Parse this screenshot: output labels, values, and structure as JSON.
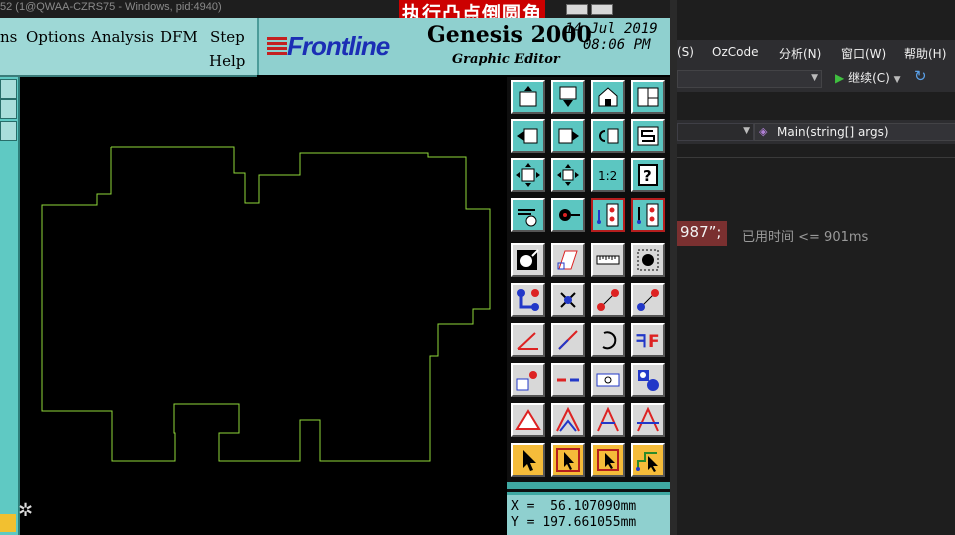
{
  "window": {
    "title": "52 (1@QWAA-CZRS75 - Windows, pid:4940)",
    "overlay_caption": "执行凸点倒圆角"
  },
  "menubar": {
    "items": [
      "ns",
      "Options",
      "Analysis",
      "DFM",
      "Step"
    ],
    "help": "Help"
  },
  "header": {
    "logo_text": "Frontline",
    "app_name": "Genesis 2000",
    "subtitle": "Graphic Editor",
    "date": "14 Jul 2019",
    "time": "08:06 PM"
  },
  "coords": {
    "x_label": "X",
    "x_value": "56.107090mm",
    "y_label": "Y",
    "y_value": "197.661055mm"
  },
  "ide": {
    "menu": [
      "(S)",
      "OzCode",
      "分析(N)",
      "窗口(W)",
      "帮助(H)"
    ],
    "continue_label": "继续(C)",
    "nav_method": "Main(string[] args)",
    "code_fragment": "987”;",
    "perf_tip": "已用时间 <= 901ms"
  },
  "colors": {
    "teal_panel": "#8fd0cf",
    "shape_outline": "#8fd83a",
    "ide_background": "#1e1e1e",
    "highlight_red": "#b51e1e"
  },
  "icons": [
    "open-job-icon",
    "save-icon",
    "home-icon",
    "window-layout-icon",
    "zoom-in-arrow-icon",
    "zoom-out-arrow-icon",
    "undo-zoom-icon",
    "snake-shape-icon",
    "fit-all-icon",
    "fit-center-icon",
    "scale-1-2-icon",
    "help-question-icon",
    "tools-palette-icon",
    "measure-pad-icon",
    "netlist-blue-icon",
    "netlist-black-icon",
    "pad-select-icon",
    "polygon-select-icon",
    "ruler-icon",
    "dashed-pad-icon",
    "connect-nodes-icon",
    "cross-delete-icon",
    "move-point-icon",
    "move-point-2-icon",
    "angle-line-icon",
    "diagonal-line-icon",
    "rotate-icon",
    "mirror-f-icon",
    "resize-icon",
    "line-break-icon",
    "slot-icon",
    "pad-group-icon",
    "triangle-icon",
    "arch-up-icon",
    "arch-a-icon",
    "arch-b-icon",
    "pointer-icon",
    "pointer-box-icon",
    "pointer-diamond-icon",
    "pointer-route-icon"
  ]
}
